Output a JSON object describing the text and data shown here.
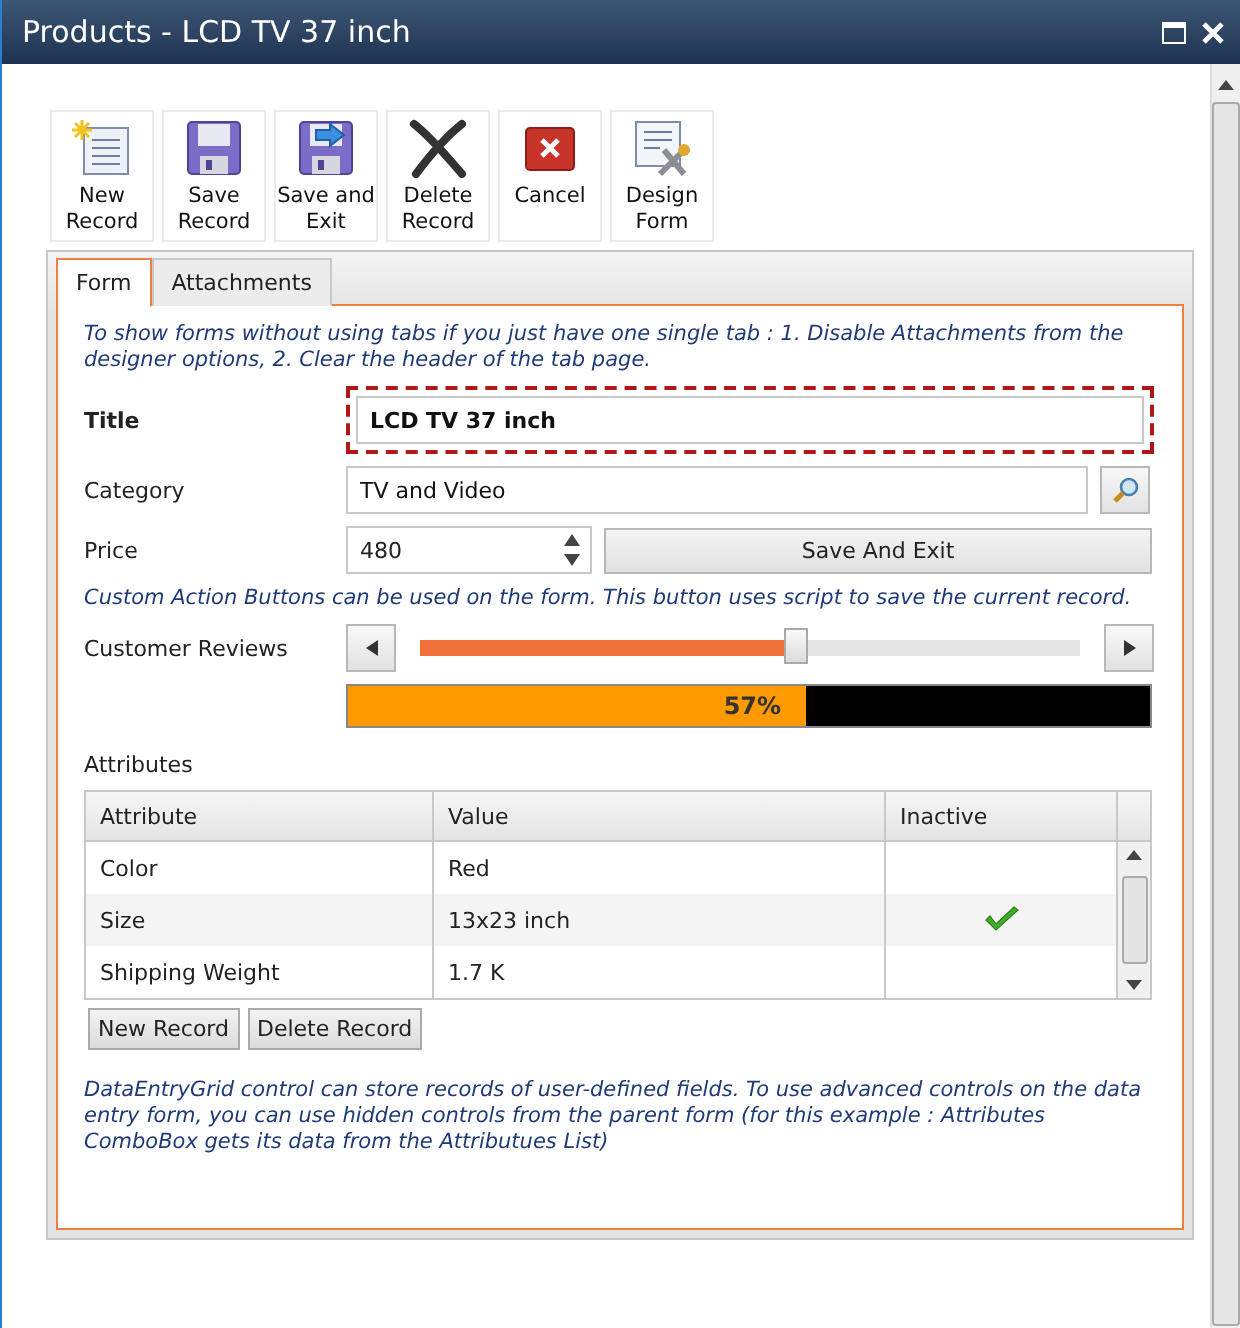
{
  "window": {
    "title": "Products - LCD TV 37 inch"
  },
  "toolbar": [
    {
      "kind": "new",
      "label": "New Record"
    },
    {
      "kind": "save",
      "label": "Save Record"
    },
    {
      "kind": "saveexit",
      "label": "Save and Exit"
    },
    {
      "kind": "delete",
      "label": "Delete Record"
    },
    {
      "kind": "cancel",
      "label": "Cancel"
    },
    {
      "kind": "design",
      "label": "Design Form"
    }
  ],
  "tabs": [
    {
      "label": "Form",
      "selected": true
    },
    {
      "label": "Attachments",
      "selected": false
    }
  ],
  "note_top": "To show forms without using tabs if you just have one single tab : 1. Disable Attachments from the designer options, 2. Clear the header of the tab page.",
  "title_field": {
    "label": "Title",
    "value": "LCD TV 37 inch",
    "focused": true
  },
  "category_field": {
    "label": "Category",
    "value": "TV and Video"
  },
  "price_field": {
    "label": "Price",
    "value": "480"
  },
  "action_button": "Save And Exit",
  "note_action": "Custom Action Buttons can be used on the form. This button uses script to save the current record.",
  "reviews": {
    "label": "Customer Reviews",
    "level": 0.57,
    "progress": {
      "level": 0.57,
      "reading": "57%"
    }
  },
  "attributes": {
    "label": "Attributes",
    "columns": [
      "Attribute",
      "Value",
      "Inactive"
    ],
    "rows": [
      {
        "attribute": "Color",
        "value": "Red",
        "inactive": false
      },
      {
        "attribute": "Size",
        "value": "13x23 inch",
        "inactive": true
      },
      {
        "attribute": "Shipping Weight",
        "value": "1.7 K",
        "inactive": false
      }
    ],
    "buttons": [
      "New Record",
      "Delete Record"
    ]
  },
  "note_bottom": "DataEntryGrid control can store records of user-defined fields. To use advanced controls on the data entry form, you can use hidden controls from the parent form (for this example : Attributes ComboBox gets its data from the Attributues List)"
}
